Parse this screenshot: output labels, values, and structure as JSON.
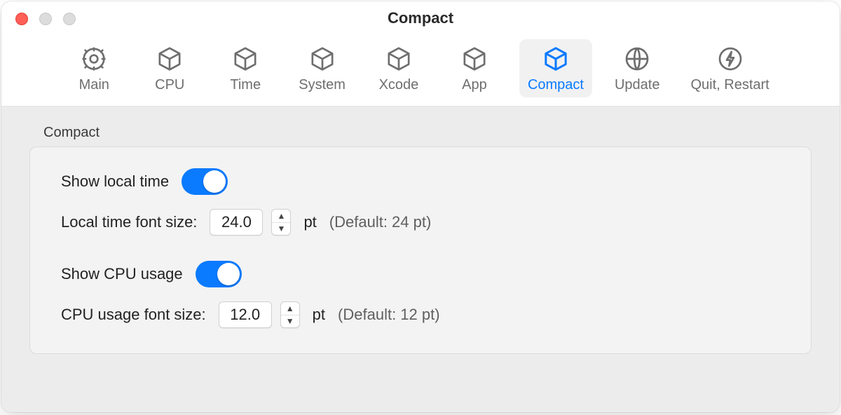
{
  "window": {
    "title": "Compact"
  },
  "toolbar": {
    "items": [
      {
        "label": "Main"
      },
      {
        "label": "CPU"
      },
      {
        "label": "Time"
      },
      {
        "label": "System"
      },
      {
        "label": "Xcode"
      },
      {
        "label": "App"
      },
      {
        "label": "Compact"
      },
      {
        "label": "Update"
      },
      {
        "label": "Quit, Restart"
      }
    ],
    "active_index": 6
  },
  "section": {
    "title": "Compact",
    "show_local_time_label": "Show local time",
    "local_time_font_size_label": "Local time font size:",
    "local_time_font_size_value": "24.0",
    "pt_label": "pt",
    "local_time_default_hint": "(Default: 24 pt)",
    "show_cpu_usage_label": "Show CPU usage",
    "cpu_usage_font_size_label": "CPU usage font size:",
    "cpu_usage_font_size_value": "12.0",
    "cpu_usage_default_hint": "(Default: 12 pt)"
  }
}
